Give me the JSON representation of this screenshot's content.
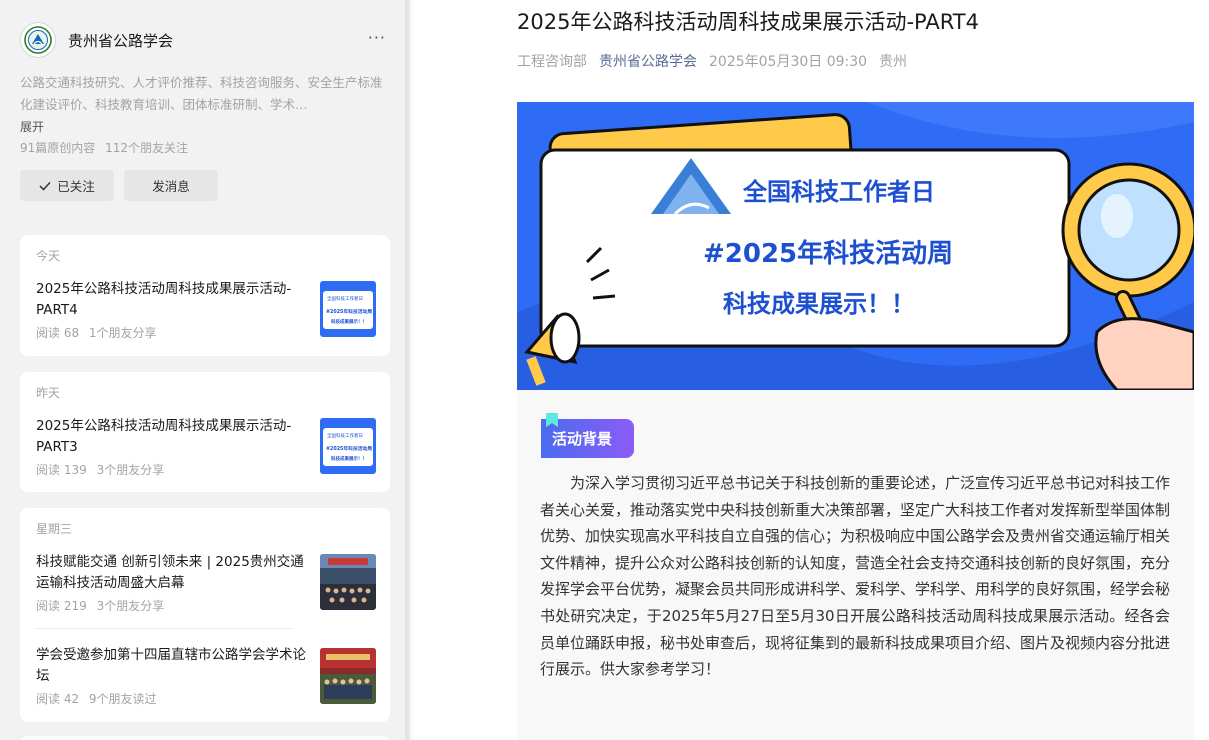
{
  "account": {
    "name": "贵州省公路学会",
    "description": "公路交通科技研究、人才评价推荐、科技咨询服务、安全生产标准化建设评价、科技教育培训、团体标准研制、学术…",
    "expand": "展开",
    "original_count": "91篇原创内容",
    "friends_follow": "112个朋友关注",
    "follow_label": "已关注",
    "message_label": "发消息",
    "more": "···"
  },
  "history": [
    {
      "label": "今天",
      "items": [
        {
          "title": "2025年公路科技活动周科技成果展示活动-PART4",
          "reads": "阅读 68",
          "social": "1个朋友分享"
        }
      ]
    },
    {
      "label": "昨天",
      "items": [
        {
          "title": "2025年公路科技活动周科技成果展示活动-PART3",
          "reads": "阅读 139",
          "social": "3个朋友分享"
        }
      ]
    },
    {
      "label": "星期三",
      "items": [
        {
          "title": "科技赋能交通 创新引领未来 | 2025贵州交通运输科技活动周盛大启幕",
          "reads": "阅读 219",
          "social": "3个朋友分享"
        },
        {
          "title": "学会受邀参加第十四届直辖市公路学会学术论坛",
          "reads": "阅读 42",
          "social": "9个朋友读过"
        }
      ]
    }
  ],
  "thumb": {
    "line1": "全国科技工作者日",
    "line2": "#2025年科技活动周",
    "line3": "科技成果展示！！"
  },
  "article": {
    "title": "2025年公路科技活动周科技成果展示活动-PART4",
    "author": "工程咨询部",
    "account": "贵州省公路学会",
    "datetime": "2025年05月30日 09:30",
    "location": "贵州",
    "banner": {
      "line1": "全国科技工作者日",
      "line2": "#2025年科技活动周",
      "line3": "科技成果展示！！"
    },
    "section_tag": "活动背景",
    "paragraph": "为深入学习贯彻习近平总书记关于科技创新的重要论述，广泛宣传习近平总书记对科技工作者关心关爱，推动落实党中央科技创新重大决策部署，坚定广大科技工作者对发挥新型举国体制优势、加快实现高水平科技自立自强的信心；为积极响应中国公路学会及贵州省交通运输厅相关文件精神，提升公众对公路科技创新的认知度，营造全社会支持交通科技创新的良好氛围，充分发挥学会平台优势，凝聚会员共同形成讲科学、爱科学、学科学、用科学的良好氛围，经学会秘书处研究决定，于2025年5月27日至5月30日开展公路科技活动周科技成果展示活动。经各会员单位踊跃申报，秘书处审查后，现将征集到的最新科技成果项目介绍、图片及视频内容分批进行展示。供大家参考学习！"
  },
  "colors": {
    "accent_link": "#576b95",
    "banner_blue": "#2f6cf6",
    "banner_text": "#1d4fd1",
    "tag_gradient_start": "#4a6cf0",
    "tag_gradient_end": "#8b5cf6"
  }
}
